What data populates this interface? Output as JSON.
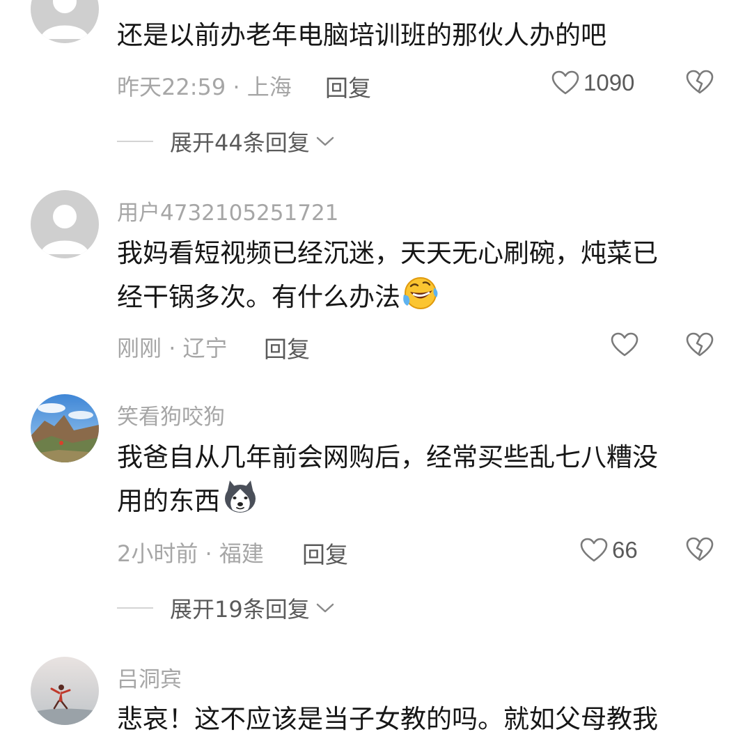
{
  "comments": [
    {
      "username": "",
      "lines": [
        "还是以前办老年电脑培训班的那伙人办的吧"
      ],
      "time": "昨天22:59",
      "location": "上海",
      "reply_label": "回复",
      "likes": "1090",
      "expand_label": "展开44条回复",
      "avatar": "default-avatar"
    },
    {
      "username": "用户4732105251721",
      "lines": [
        "我妈看短视频已经沉迷，天天无心刷碗，炖菜已",
        "经干锅多次。有什么办法"
      ],
      "emoji": "rolling-laughing-emoji",
      "time": "刚刚",
      "location": "辽宁",
      "reply_label": "回复",
      "likes": "",
      "avatar": "default-avatar"
    },
    {
      "username": "笑看狗咬狗",
      "lines": [
        "我爸自从几年前会网购后，经常买些乱七八糟没",
        "用的东西"
      ],
      "emoji": "husky-dog-emoji",
      "time": "2小时前",
      "location": "福建",
      "reply_label": "回复",
      "likes": "66",
      "expand_label": "展开19条回复",
      "avatar": "mountain-landscape-photo"
    },
    {
      "username": "吕洞宾",
      "lines": [
        "悲哀！这不应该是当子女教的吗。就如父母教我"
      ],
      "avatar": "dancer-photo"
    }
  ],
  "meta_separator": " · ",
  "colors": {
    "secondary_text": "#a6a6a6",
    "primary_text": "#161616",
    "action_text": "#5a5a5a",
    "divider": "#d4d4d4"
  }
}
